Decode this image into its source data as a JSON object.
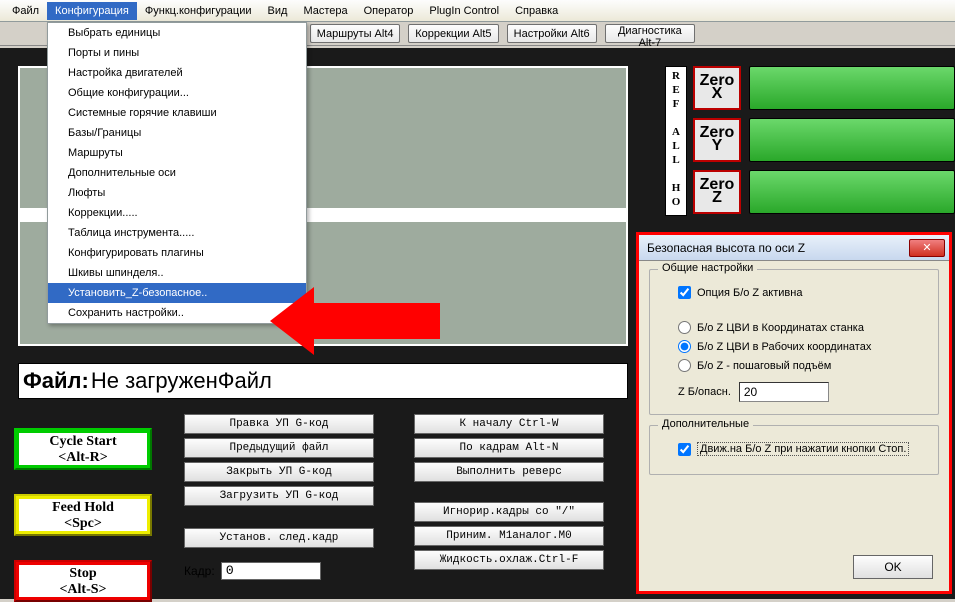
{
  "menubar": [
    "Файл",
    "Конфигурация",
    "Функц.конфигурации",
    "Вид",
    "Мастера",
    "Оператор",
    "PlugIn Control",
    "Справка"
  ],
  "active_menu_index": 1,
  "tabs": [
    "Маршруты Alt4",
    "Коррекции Alt5",
    "Настройки Alt6",
    "Диагностика Alt-7"
  ],
  "dropdown": [
    "Выбрать единицы",
    "Порты и пины",
    "Настройка двигателей",
    "Общие конфигурации...",
    "Системные горячие клавиши",
    "Базы/Границы",
    "Маршруты",
    "Дополнительные оси",
    "Люфты",
    "Коррекции.....",
    "Таблица инструмента.....",
    "Конфигурировать плагины",
    "Шкивы шпинделя..",
    "Установить_Z-безопасное..",
    "Сохранить настройки.."
  ],
  "dropdown_highlight_index": 13,
  "ref_label": "REF ALL HO",
  "zero": [
    {
      "label": "Zero",
      "axis": "X"
    },
    {
      "label": "Zero",
      "axis": "Y"
    },
    {
      "label": "Zero",
      "axis": "Z"
    }
  ],
  "file_line": {
    "label": "Файл:",
    "value": "Не загруженФайл"
  },
  "ctrl_buttons": {
    "cycle": "Cycle Start\n<Alt-R>",
    "feed": "Feed Hold\n<Spc>",
    "stop": "Stop\n<Alt-S>"
  },
  "mid_col1": [
    "Правка УП G-код",
    "Предыдущий файл",
    "Закрыть УП G-код",
    "Загрузить УП G-код",
    "Установ. след.кадр"
  ],
  "mid_col2": [
    "К началу Ctrl-W",
    "По кадрам Alt-N",
    "Выполнить реверс",
    "Игнорир.кадры со \"/\"",
    "Приним. M1аналог.M0",
    "Жидкость.охлаж.Ctrl-F"
  ],
  "kadr": {
    "label": "Кадр:",
    "value": "0"
  },
  "dialog": {
    "title": "Безопасная высота по оси Z",
    "group1": {
      "legend": "Общие настройки",
      "opt_active": "Опция Б/о Z активна",
      "rad1": "Б/о Z ЦВИ в Координатах станка",
      "rad2": "Б/о Z ЦВИ в Рабочих координатах",
      "rad3": "Б/о Z - пошаговый подъём",
      "field_label": "Z Б/опасн.",
      "field_value": "20"
    },
    "group2": {
      "legend": "Дополнительные",
      "chk": "Движ.на Б/о Z при нажатии кнопки Стоп."
    },
    "ok": "OK"
  }
}
